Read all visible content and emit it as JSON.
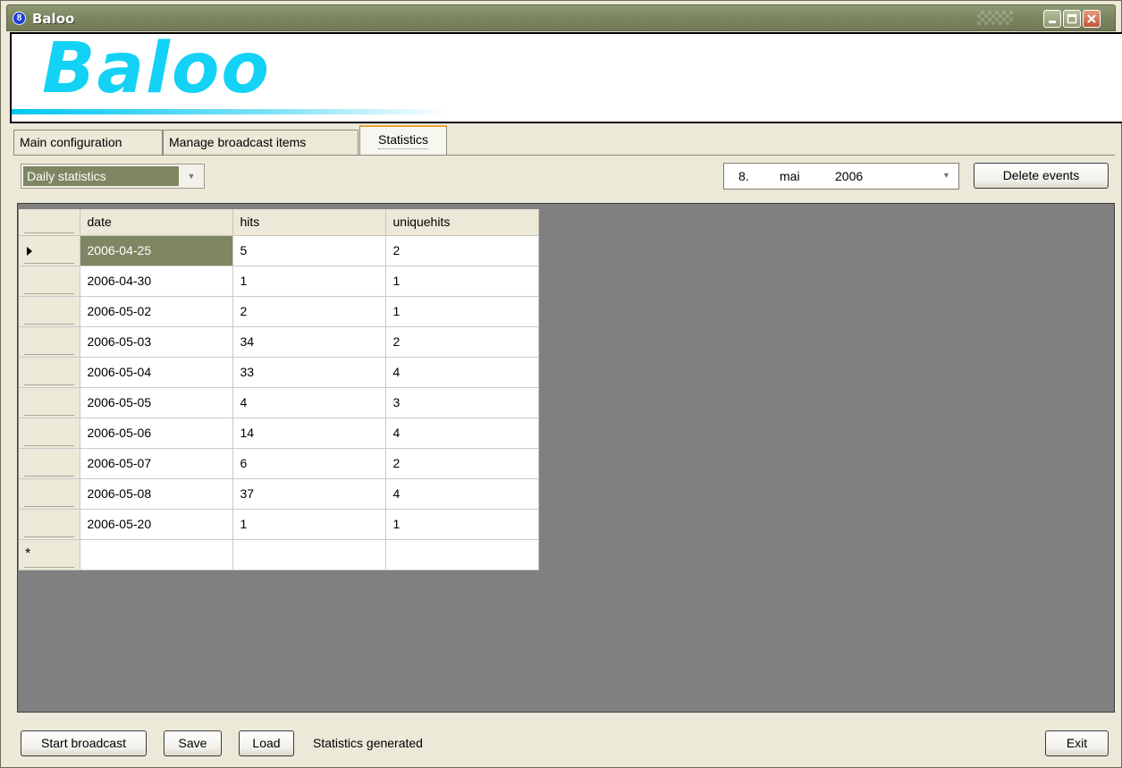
{
  "window": {
    "title": "Baloo"
  },
  "banner": {
    "logo_text": "Baloo"
  },
  "tabs": [
    {
      "label": "Main configuration"
    },
    {
      "label": "Manage broadcast items"
    },
    {
      "label": "Statistics",
      "active": true
    }
  ],
  "toolbar": {
    "stats_type": {
      "selected": "Daily statistics"
    },
    "date": {
      "day": "8.",
      "month": "mai",
      "year": "2006"
    },
    "delete_label": "Delete events"
  },
  "grid": {
    "columns": [
      "date",
      "hits",
      "uniquehits"
    ],
    "rows": [
      [
        "2006-04-25",
        "5",
        "2"
      ],
      [
        "2006-04-30",
        "1",
        "1"
      ],
      [
        "2006-05-02",
        "2",
        "1"
      ],
      [
        "2006-05-03",
        "34",
        "2"
      ],
      [
        "2006-05-04",
        "33",
        "4"
      ],
      [
        "2006-05-05",
        "4",
        "3"
      ],
      [
        "2006-05-06",
        "14",
        "4"
      ],
      [
        "2006-05-07",
        "6",
        "2"
      ],
      [
        "2006-05-08",
        "37",
        "4"
      ],
      [
        "2006-05-20",
        "1",
        "1"
      ]
    ],
    "new_row_marker": "*"
  },
  "bottom": {
    "start_label": "Start broadcast",
    "save_label": "Save",
    "load_label": "Load",
    "status": "Statistics generated",
    "exit_label": "Exit"
  },
  "colors": {
    "titlebar": "#7b8661",
    "selection": "#7e8662",
    "logo": "#14d2f5",
    "grid_background": "#808080"
  }
}
